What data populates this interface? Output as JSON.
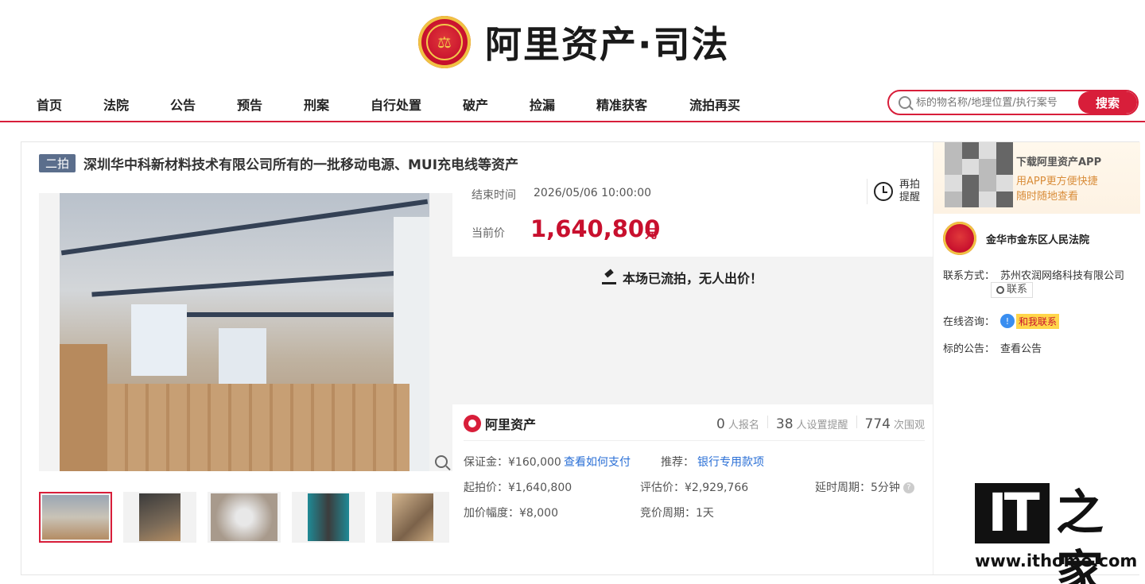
{
  "header": {
    "logo_text": "阿里资产·司法"
  },
  "nav": {
    "items": [
      "首页",
      "法院",
      "公告",
      "预告",
      "刑案",
      "自行处置",
      "破产",
      "捡漏",
      "精准获客",
      "流拍再买"
    ]
  },
  "search": {
    "placeholder": "标的物名称/地理位置/执行案号",
    "button_label": "搜索"
  },
  "auction": {
    "round_badge": "二拍",
    "title": "深圳华中科新材料技术有限公司所有的一批移动电源、MUI充电线等资产",
    "end_time_label": "结束时间",
    "end_time": "2026/05/06 10:00:00",
    "current_price_label": "当前价",
    "current_price": "1,640,800",
    "price_unit": "元",
    "remind_label": "再拍提醒",
    "status_text": "本场已流拍，无人出价！",
    "platform_name": "阿里资产",
    "stats": {
      "signups": "0",
      "signups_label": "人报名",
      "reminders": "38",
      "reminders_label": "人设置提醒",
      "views": "774",
      "views_label": "次围观"
    },
    "details": {
      "deposit": "保证金：¥160,000",
      "how_to_pay": "查看如何支付",
      "recommend_label": "推荐：",
      "recommend_link": "银行专用款项",
      "start_price": "起拍价：¥1,640,800",
      "appraisal": "评估价：¥2,929,766",
      "delay_period": "延时周期：5分钟",
      "increment": "加价幅度：¥8,000",
      "bid_period": "竞价周期：1天"
    }
  },
  "sidebar": {
    "app_title": "下载阿里资产APP",
    "app_sub1": "用APP更方便快捷",
    "app_sub2": "随时随地查看",
    "court_name": "金华市金东区人民法院",
    "contact_label": "联系方式：",
    "contact_value": "苏州农润网络科技有限公司",
    "contact_button": "联系",
    "consult_label": "在线咨询：",
    "consult_button": "和我联系",
    "notice_label": "标的公告：",
    "notice_link": "查看公告"
  },
  "watermark": {
    "brand_it": "IT",
    "brand_home": "之家",
    "url": "www.ithome.com"
  },
  "colors": {
    "accent": "#d81e3a",
    "price": "#c8102e",
    "link": "#2a6fd6"
  }
}
